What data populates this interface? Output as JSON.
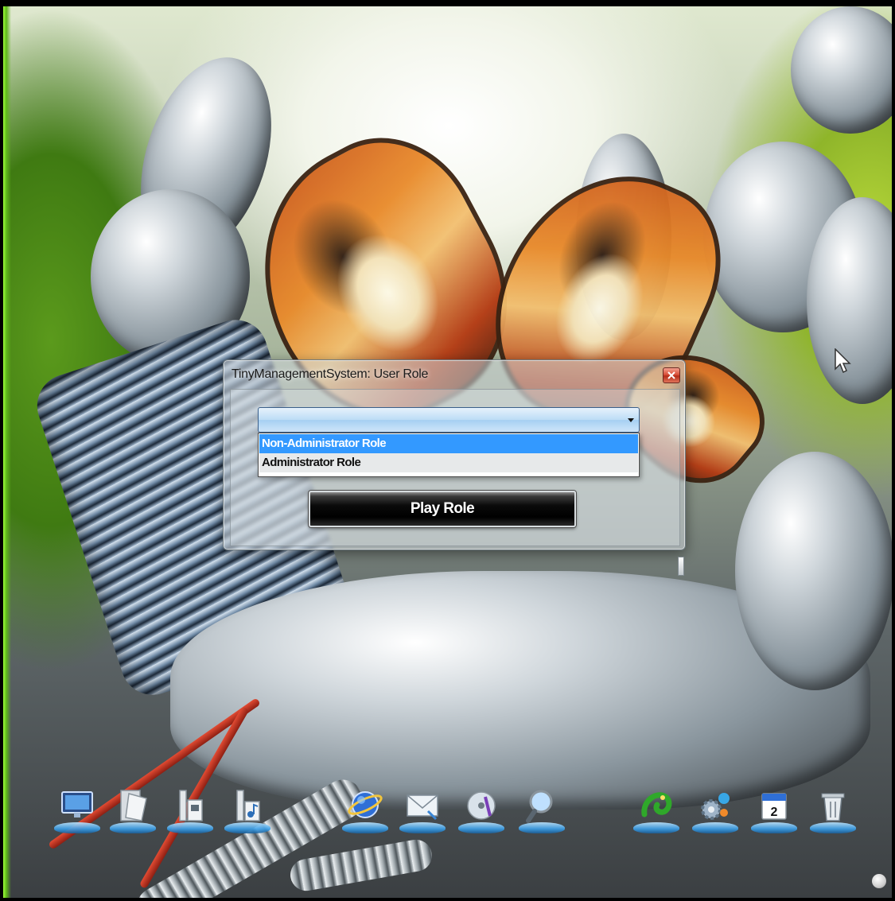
{
  "dialog": {
    "title": "TinyManagementSystem: User Role",
    "select_value": "",
    "options": [
      "Non-Administrator Role",
      "Administrator Role"
    ],
    "selected_index": 0,
    "play_button_label": "Play Role"
  },
  "dock": {
    "icons": [
      "monitor-icon",
      "documents-folder-icon",
      "file-folder-icon",
      "music-folder-icon",
      "internet-globe-icon",
      "mail-icon",
      "media-disc-icon",
      "search-icon",
      "gecko-app-icon",
      "settings-gear-icon",
      "calendar-icon",
      "recycle-bin-icon"
    ],
    "calendar_day": "2"
  },
  "colors": {
    "selection": "#3399ff",
    "accent_green": "#9dff3a",
    "close_red": "#d9503a"
  }
}
